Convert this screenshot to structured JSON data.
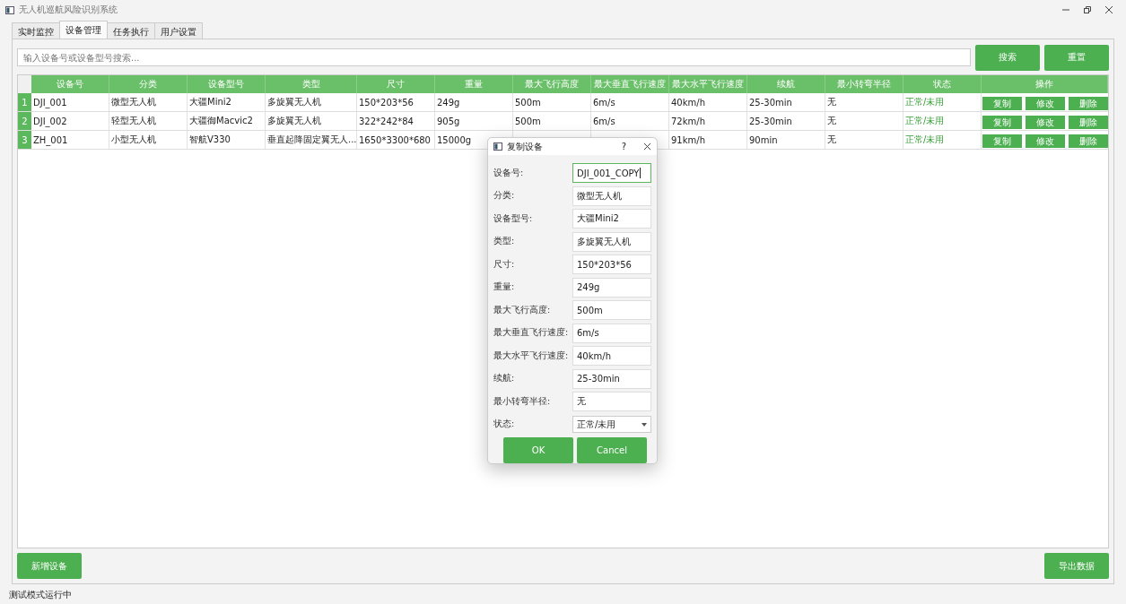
{
  "window": {
    "title": "无人机巡航风险识别系统"
  },
  "tabs": [
    {
      "label": "实时监控",
      "selected": false
    },
    {
      "label": "设备管理",
      "selected": true
    },
    {
      "label": "任务执行",
      "selected": false
    },
    {
      "label": "用户设置",
      "selected": false
    }
  ],
  "search": {
    "placeholder": "输入设备号或设备型号搜索...",
    "search_button": "搜索",
    "reset_button": "重置"
  },
  "table": {
    "columns": [
      "设备号",
      "分类",
      "设备型号",
      "类型",
      "尺寸",
      "重量",
      "最大飞行高度",
      "最大垂直飞行速度",
      "最大水平飞行速度",
      "续航",
      "最小转弯半径",
      "状态",
      "操作"
    ],
    "rows": [
      {
        "number": "1",
        "cells": [
          "DJI_001",
          "微型无人机",
          "大疆Mini2",
          "多旋翼无人机",
          "150*203*56",
          "249g",
          "500m",
          "6m/s",
          "40km/h",
          "25-30min",
          "无",
          "正常/未用"
        ],
        "actions": [
          "复制",
          "修改",
          "删除"
        ]
      },
      {
        "number": "2",
        "cells": [
          "DJI_002",
          "轻型无人机",
          "大疆御Macvic2",
          "多旋翼无人机",
          "322*242*84",
          "905g",
          "500m",
          "6m/s",
          "72km/h",
          "25-30min",
          "无",
          "正常/未用"
        ],
        "actions": [
          "复制",
          "修改",
          "删除"
        ]
      },
      {
        "number": "3",
        "cells": [
          "ZH_001",
          "小型无人机",
          "智航V330",
          "垂直起降固定翼无人...",
          "1650*3300*680",
          "15000g",
          null,
          null,
          "91km/h",
          "90min",
          "无",
          "正常/未用"
        ],
        "actions": [
          "复制",
          "修改",
          "删除"
        ]
      }
    ]
  },
  "footer": {
    "add_button": "新增设备",
    "export_button": "导出数据"
  },
  "status_bar": "测试模式运行中",
  "dialog": {
    "title": "复制设备",
    "help": "?",
    "fields": [
      {
        "label": "设备号:",
        "value": "DJI_001_COPY",
        "kind": "text",
        "focused": true
      },
      {
        "label": "分类:",
        "value": "微型无人机",
        "kind": "text",
        "focused": false
      },
      {
        "label": "设备型号:",
        "value": "大疆Mini2",
        "kind": "text",
        "focused": false
      },
      {
        "label": "类型:",
        "value": "多旋翼无人机",
        "kind": "text",
        "focused": false
      },
      {
        "label": "尺寸:",
        "value": "150*203*56",
        "kind": "text",
        "focused": false
      },
      {
        "label": "重量:",
        "value": "249g",
        "kind": "text",
        "focused": false
      },
      {
        "label": "最大飞行高度:",
        "value": "500m",
        "kind": "text",
        "focused": false
      },
      {
        "label": "最大垂直飞行速度:",
        "value": "6m/s",
        "kind": "text",
        "focused": false
      },
      {
        "label": "最大水平飞行速度:",
        "value": "40km/h",
        "kind": "text",
        "focused": false
      },
      {
        "label": "续航:",
        "value": "25-30min",
        "kind": "text",
        "focused": false
      },
      {
        "label": "最小转弯半径:",
        "value": "无",
        "kind": "text",
        "focused": false
      },
      {
        "label": "状态:",
        "value": "正常/未用",
        "kind": "select",
        "focused": false
      }
    ],
    "ok_button": "OK",
    "cancel_button": "Cancel"
  }
}
